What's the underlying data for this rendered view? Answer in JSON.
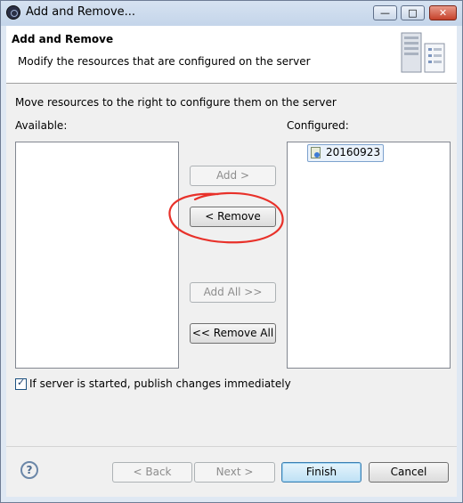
{
  "window": {
    "title": "Add and Remove...",
    "minimize": "—",
    "maximize": "□",
    "close": "✕"
  },
  "header": {
    "title": "Add and Remove",
    "description": "Modify the resources that are configured on the server",
    "icon": "server-icon"
  },
  "main": {
    "instruction": "Move resources to the right to configure them on the server",
    "available_label": "Available:",
    "configured_label": "Configured:",
    "available_items": [],
    "configured_items": [
      {
        "label": "20160923",
        "icon": "web-module-icon"
      }
    ],
    "buttons": {
      "add": "Add >",
      "remove": "< Remove",
      "add_all": "Add All >>",
      "remove_all": "<< Remove All"
    },
    "publish_checkbox": {
      "label": "If server is started, publish changes immediately",
      "checked": true
    }
  },
  "annotation": {
    "color": "#e8312a"
  },
  "footer": {
    "help": "?",
    "back": "< Back",
    "next": "Next >",
    "finish": "Finish",
    "cancel": "Cancel"
  }
}
